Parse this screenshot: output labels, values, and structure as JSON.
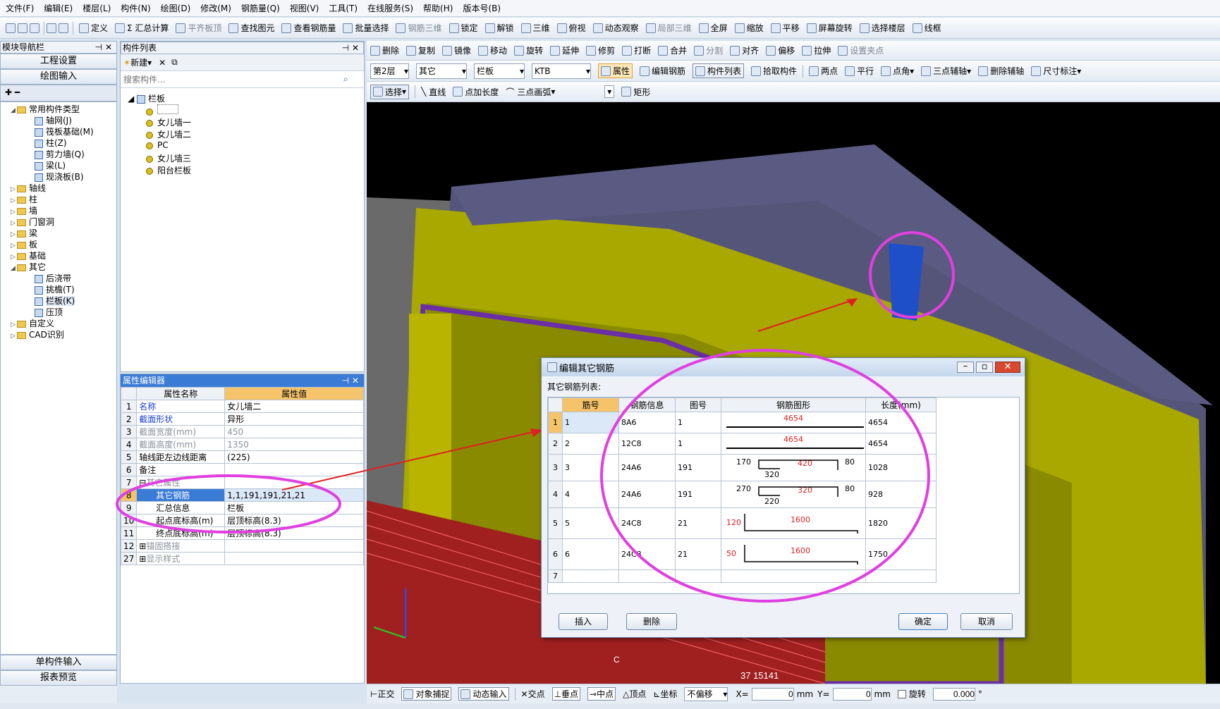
{
  "menu": [
    "文件(F)",
    "编辑(E)",
    "楼层(L)",
    "构件(N)",
    "绘图(D)",
    "修改(M)",
    "钢筋量(Q)",
    "视图(V)",
    "工具(T)",
    "在线服务(S)",
    "帮助(H)",
    "版本号(B)"
  ],
  "toolbar1": [
    {
      "label": "定义",
      "dim": false
    },
    {
      "label": "Σ 汇总计算",
      "dim": false
    },
    {
      "label": "平齐板顶",
      "dim": true
    },
    {
      "label": "查找图元",
      "dim": false
    },
    {
      "label": "查看钢筋量",
      "dim": false
    },
    {
      "label": "批量选择",
      "dim": false
    },
    {
      "label": "钢筋三维",
      "dim": true
    },
    {
      "label": "锁定",
      "dim": false
    },
    {
      "label": "解锁",
      "dim": false
    },
    {
      "label": "三维",
      "dim": false
    },
    {
      "label": "俯视",
      "dim": false
    },
    {
      "label": "动态观察",
      "dim": false
    },
    {
      "label": "局部三维",
      "dim": true
    },
    {
      "label": "全屏",
      "dim": false
    },
    {
      "label": "缩放",
      "dim": false
    },
    {
      "label": "平移",
      "dim": false
    },
    {
      "label": "屏幕旋转",
      "dim": false
    },
    {
      "label": "选择楼层",
      "dim": false
    },
    {
      "label": "线框",
      "dim": false
    }
  ],
  "toolbar2": [
    {
      "label": "删除",
      "dim": false
    },
    {
      "label": "复制",
      "dim": false
    },
    {
      "label": "镜像",
      "dim": false
    },
    {
      "label": "移动",
      "dim": false
    },
    {
      "label": "旋转",
      "dim": false
    },
    {
      "label": "延伸",
      "dim": false
    },
    {
      "label": "修剪",
      "dim": false
    },
    {
      "label": "打断",
      "dim": false
    },
    {
      "label": "合并",
      "dim": false
    },
    {
      "label": "分割",
      "dim": true
    },
    {
      "label": "对齐",
      "dim": false
    },
    {
      "label": "偏移",
      "dim": false
    },
    {
      "label": "拉伸",
      "dim": false
    },
    {
      "label": "设置夹点",
      "dim": true
    }
  ],
  "toolbar3": {
    "floor": "第2层",
    "type": "其它",
    "comp": "栏板",
    "code": "KTB",
    "props": "属性",
    "edit_rebar": "编辑钢筋",
    "comp_list": "构件列表",
    "pick": "拾取构件",
    "two_pts": "两点",
    "parallel": "平行",
    "pt_angle": "点角",
    "three_pt_aux": "三点辅轴",
    "del_aux": "删除辅轴",
    "dim_mark": "尺寸标注"
  },
  "toolbar4": {
    "select": "选择",
    "line": "直线",
    "pt_len": "点加长度",
    "arc": "三点画弧",
    "rect": "矩形"
  },
  "nav": {
    "title": "模块导航栏",
    "btn1": "工程设置",
    "btn2": "绘图输入",
    "bottom1": "单构件输入",
    "bottom2": "报表预览"
  },
  "tree": [
    {
      "lv": 0,
      "icon": "folder",
      "text": "常用构件类型",
      "exp": "◢"
    },
    {
      "lv": 1,
      "icon": "sm",
      "text": "轴网(J)"
    },
    {
      "lv": 1,
      "icon": "sm",
      "text": "筏板基础(M)"
    },
    {
      "lv": 1,
      "icon": "sm",
      "text": "柱(Z)"
    },
    {
      "lv": 1,
      "icon": "sm",
      "text": "剪力墙(Q)"
    },
    {
      "lv": 1,
      "icon": "sm",
      "text": "梁(L)"
    },
    {
      "lv": 1,
      "icon": "sm",
      "text": "现浇板(B)"
    },
    {
      "lv": 0,
      "icon": "folder",
      "text": "轴线",
      "exp": "▷"
    },
    {
      "lv": 0,
      "icon": "folder",
      "text": "柱",
      "exp": "▷"
    },
    {
      "lv": 0,
      "icon": "folder",
      "text": "墙",
      "exp": "▷"
    },
    {
      "lv": 0,
      "icon": "folder",
      "text": "门窗洞",
      "exp": "▷"
    },
    {
      "lv": 0,
      "icon": "folder",
      "text": "梁",
      "exp": "▷"
    },
    {
      "lv": 0,
      "icon": "folder",
      "text": "板",
      "exp": "▷"
    },
    {
      "lv": 0,
      "icon": "folder",
      "text": "基础",
      "exp": "▷"
    },
    {
      "lv": 0,
      "icon": "folder",
      "text": "其它",
      "exp": "◢"
    },
    {
      "lv": 1,
      "icon": "sm",
      "text": "后浇带"
    },
    {
      "lv": 1,
      "icon": "sm",
      "text": "挑檐(T)"
    },
    {
      "lv": 1,
      "icon": "sm",
      "text": "栏板(K)"
    },
    {
      "lv": 1,
      "icon": "sm",
      "text": "压顶"
    },
    {
      "lv": 0,
      "icon": "folder",
      "text": "自定义",
      "exp": "▷"
    },
    {
      "lv": 0,
      "icon": "folder",
      "text": "CAD识别",
      "exp": "▷"
    }
  ],
  "complist": {
    "title": "构件列表",
    "new": "新建",
    "search_ph": "搜索构件...",
    "root": "栏板",
    "items": [
      "",
      "女儿墙一",
      "女儿墙二",
      "PC",
      "女儿墙三",
      "阳台栏板"
    ]
  },
  "propeditor": {
    "title": "属性编辑器",
    "h_name": "属性名称",
    "h_val": "属性值",
    "rows": [
      {
        "n": "1",
        "name": "名称",
        "val": "女儿墙二",
        "blue": true
      },
      {
        "n": "2",
        "name": "截面形状",
        "val": "异形",
        "blue": true
      },
      {
        "n": "3",
        "name": "截面宽度(mm)",
        "val": "450",
        "grey": true
      },
      {
        "n": "4",
        "name": "截面高度(mm)",
        "val": "1350",
        "grey": true
      },
      {
        "n": "5",
        "name": "轴线距左边线距离",
        "val": "(225)"
      },
      {
        "n": "6",
        "name": "备注",
        "val": ""
      },
      {
        "n": "7",
        "name": "其它属性",
        "val": "",
        "grey": true,
        "group": "⊟"
      },
      {
        "n": "8",
        "name": "其它钢筋",
        "val": "1,1,191,191,21,21",
        "sel": true,
        "indent": true
      },
      {
        "n": "9",
        "name": "汇总信息",
        "val": "栏板",
        "indent": true
      },
      {
        "n": "10",
        "name": "起点底标高(m)",
        "val": "层顶标高(8.3)",
        "indent": true
      },
      {
        "n": "11",
        "name": "终点底标高(m)",
        "val": "层顶标高(8.3)",
        "indent": true
      },
      {
        "n": "12",
        "name": "锚固搭接",
        "val": "",
        "grey": true,
        "group": "⊞"
      },
      {
        "n": "27",
        "name": "显示样式",
        "val": "",
        "grey": true,
        "group": "⊞"
      }
    ]
  },
  "dialog": {
    "title": "编辑其它钢筋",
    "subtitle": "其它钢筋列表:",
    "h": [
      "筋号",
      "钢筋信息",
      "图号",
      "钢筋图形",
      "长度(mm)"
    ],
    "rows": [
      {
        "n": "1",
        "no": "1",
        "info": "8A6",
        "fig": "1",
        "len": "4654",
        "s": {
          "a": "4654"
        }
      },
      {
        "n": "2",
        "no": "2",
        "info": "12C8",
        "fig": "1",
        "len": "4654",
        "s": {
          "a": "4654"
        }
      },
      {
        "n": "3",
        "no": "3",
        "info": "24A6",
        "fig": "191",
        "len": "1028",
        "s": {
          "a": "170",
          "b": "420",
          "c": "80",
          "d": "320"
        }
      },
      {
        "n": "4",
        "no": "4",
        "info": "24A6",
        "fig": "191",
        "len": "928",
        "s": {
          "a": "270",
          "b": "320",
          "c": "80",
          "d": "220"
        }
      },
      {
        "n": "5",
        "no": "5",
        "info": "24C8",
        "fig": "21",
        "len": "1820",
        "s": {
          "a": "120",
          "b": "1600"
        }
      },
      {
        "n": "6",
        "no": "6",
        "info": "24C8",
        "fig": "21",
        "len": "1750",
        "s": {
          "a": "50",
          "b": "1600"
        }
      },
      {
        "n": "7",
        "no": "",
        "info": "",
        "fig": "",
        "len": "",
        "s": {}
      }
    ],
    "insert": "插入",
    "delete": "删除",
    "ok": "确定",
    "cancel": "取消"
  },
  "status": {
    "ortho": "正交",
    "snap": "对象捕捉",
    "dyn": "动态输入",
    "cross": "交点",
    "perp": "垂点",
    "mid": "中点",
    "vert": "顶点",
    "coord": "坐标",
    "offset": "不偏移",
    "x_label": "X=",
    "x_val": "0",
    "y_label": "Y=",
    "y_val": "0",
    "unit": "mm",
    "rotate": "旋转",
    "rot_val": "0.000",
    "deg": "°"
  },
  "canvas_text": {
    "c": "C",
    "num": "37 15141"
  }
}
